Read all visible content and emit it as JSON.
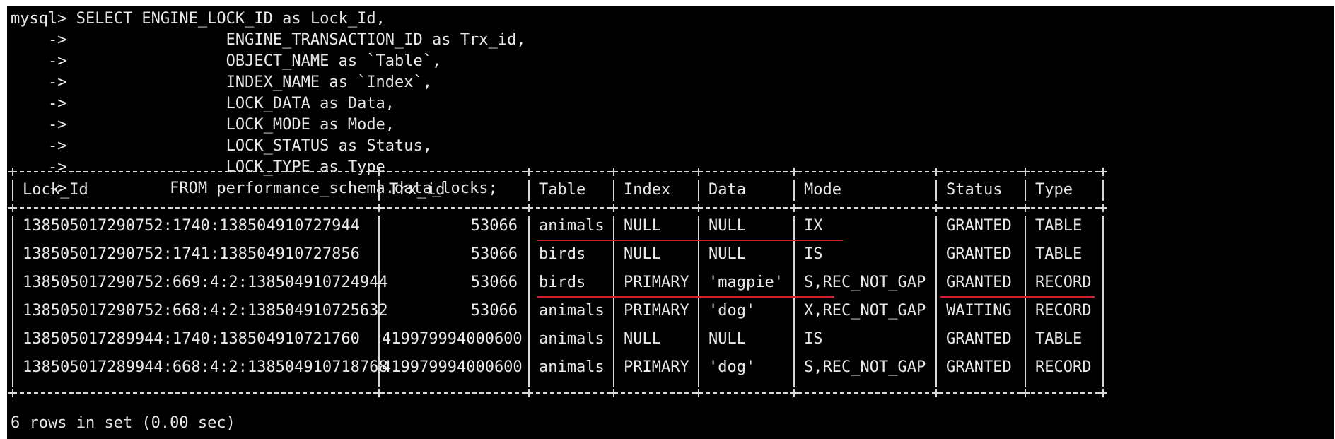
{
  "query": {
    "lines": [
      "mysql> SELECT ENGINE_LOCK_ID as Lock_Id,",
      "    ->                 ENGINE_TRANSACTION_ID as Trx_id,",
      "    ->                 OBJECT_NAME as `Table`,",
      "    ->                 INDEX_NAME as `Index`,",
      "    ->                 LOCK_DATA as Data,",
      "    ->                 LOCK_MODE as Mode,",
      "    ->                 LOCK_STATUS as Status,",
      "    ->                 LOCK_TYPE as Type",
      "    ->           FROM performance_schema.data_locks;"
    ]
  },
  "table": {
    "columns": [
      "Lock_Id",
      "Trx_id",
      "Table",
      "Index",
      "Data",
      "Mode",
      "Status",
      "Type"
    ],
    "rows": [
      [
        "138505017290752:1740:138504910727944",
        "53066",
        "animals",
        "NULL",
        "NULL",
        "IX",
        "GRANTED",
        "TABLE"
      ],
      [
        "138505017290752:1741:138504910727856",
        "53066",
        "birds",
        "NULL",
        "NULL",
        "IS",
        "GRANTED",
        "TABLE"
      ],
      [
        "138505017290752:669:4:2:138504910724944",
        "53066",
        "birds",
        "PRIMARY",
        "'magpie'",
        "S,REC_NOT_GAP",
        "GRANTED",
        "RECORD"
      ],
      [
        "138505017290752:668:4:2:138504910725632",
        "53066",
        "animals",
        "PRIMARY",
        "'dog'",
        "X,REC_NOT_GAP",
        "WAITING",
        "RECORD"
      ],
      [
        "138505017289944:1740:138504910721760",
        "419979994000600",
        "animals",
        "NULL",
        "NULL",
        "IS",
        "GRANTED",
        "TABLE"
      ],
      [
        "138505017289944:668:4:2:138504910718768",
        "419979994000600",
        "animals",
        "PRIMARY",
        "'dog'",
        "S,REC_NOT_GAP",
        "GRANTED",
        "RECORD"
      ]
    ]
  },
  "footer": "6 rows in set (0.00 sec)",
  "colors": {
    "background": "#000000",
    "text": "#e8e8e8",
    "annotation": "#d0202a"
  }
}
